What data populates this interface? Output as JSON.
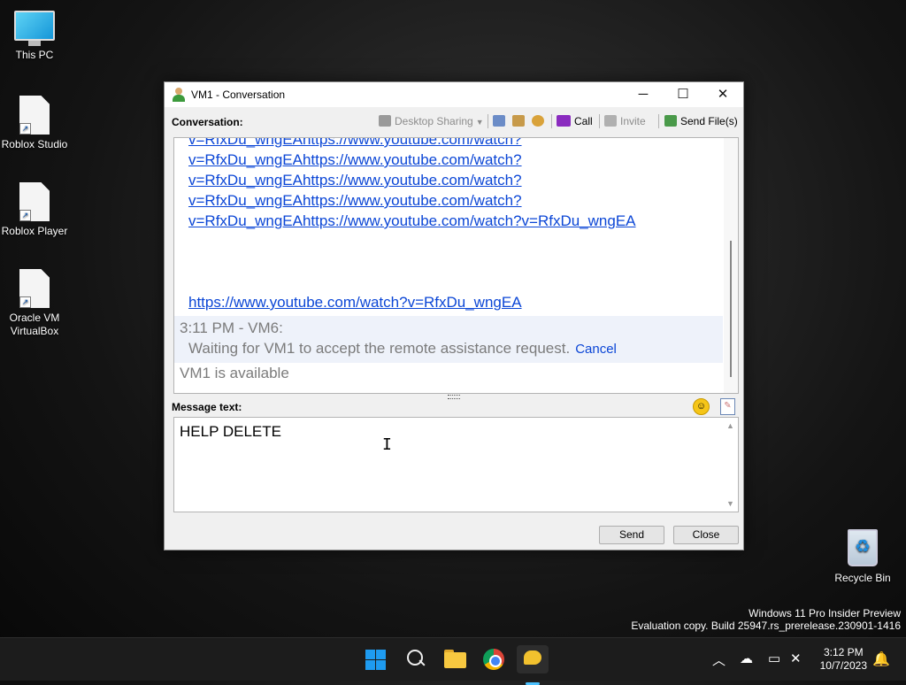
{
  "desktop": {
    "icons": [
      {
        "label": "This PC",
        "icon": "monitor-icon"
      },
      {
        "label": "Roblox Studio",
        "icon": "file-shortcut-icon"
      },
      {
        "label": "Roblox Player",
        "icon": "file-shortcut-icon"
      },
      {
        "label": "Oracle VM VirtualBox",
        "icon": "file-shortcut-icon"
      },
      {
        "label": "Recycle Bin",
        "icon": "recycle-bin-icon"
      }
    ]
  },
  "window": {
    "title": "VM1 - Conversation",
    "controls": {
      "minimize": "─",
      "maximize": "☐",
      "close": "✕"
    },
    "toolbar": {
      "conversation_label": "Conversation:",
      "desktop_sharing": "Desktop Sharing",
      "call": "Call",
      "invite": "Invite",
      "send_files": "Send File(s)"
    },
    "conversation": {
      "lines": [
        "v=RfxDu_wngEAhttps://www.youtube.com/watch?",
        "v=RfxDu_wngEAhttps://www.youtube.com/watch?",
        "v=RfxDu_wngEAhttps://www.youtube.com/watch?",
        "v=RfxDu_wngEAhttps://www.youtube.com/watch?",
        "v=RfxDu_wngEAhttps://www.youtube.com/watch?v=RfxDu_wngEA"
      ],
      "last_link": "https://www.youtube.com/watch?v=RfxDu_wngEA",
      "message_header": "3:11 PM - VM6:",
      "waiting_text": "Waiting for VM1 to accept the remote assistance request.",
      "cancel_link": "Cancel",
      "status_text": "VM1 is available"
    },
    "message": {
      "label": "Message text:",
      "value": "HELP DELETE"
    },
    "buttons": {
      "send": "Send",
      "close": "Close"
    }
  },
  "watermark": {
    "line1": "Windows 11 Pro Insider Preview",
    "line2": "Evaluation copy. Build 25947.rs_prerelease.230901-1416"
  },
  "taskbar": {
    "apps": [
      "start-icon",
      "search-icon",
      "file-explorer-icon",
      "chrome-icon",
      "messenger-icon"
    ],
    "time": "3:12 PM",
    "date": "10/7/2023",
    "tray": {
      "chevron": "︿"
    }
  },
  "colors": {
    "link": "#0b46d6",
    "accent": "#4cc2ff"
  }
}
